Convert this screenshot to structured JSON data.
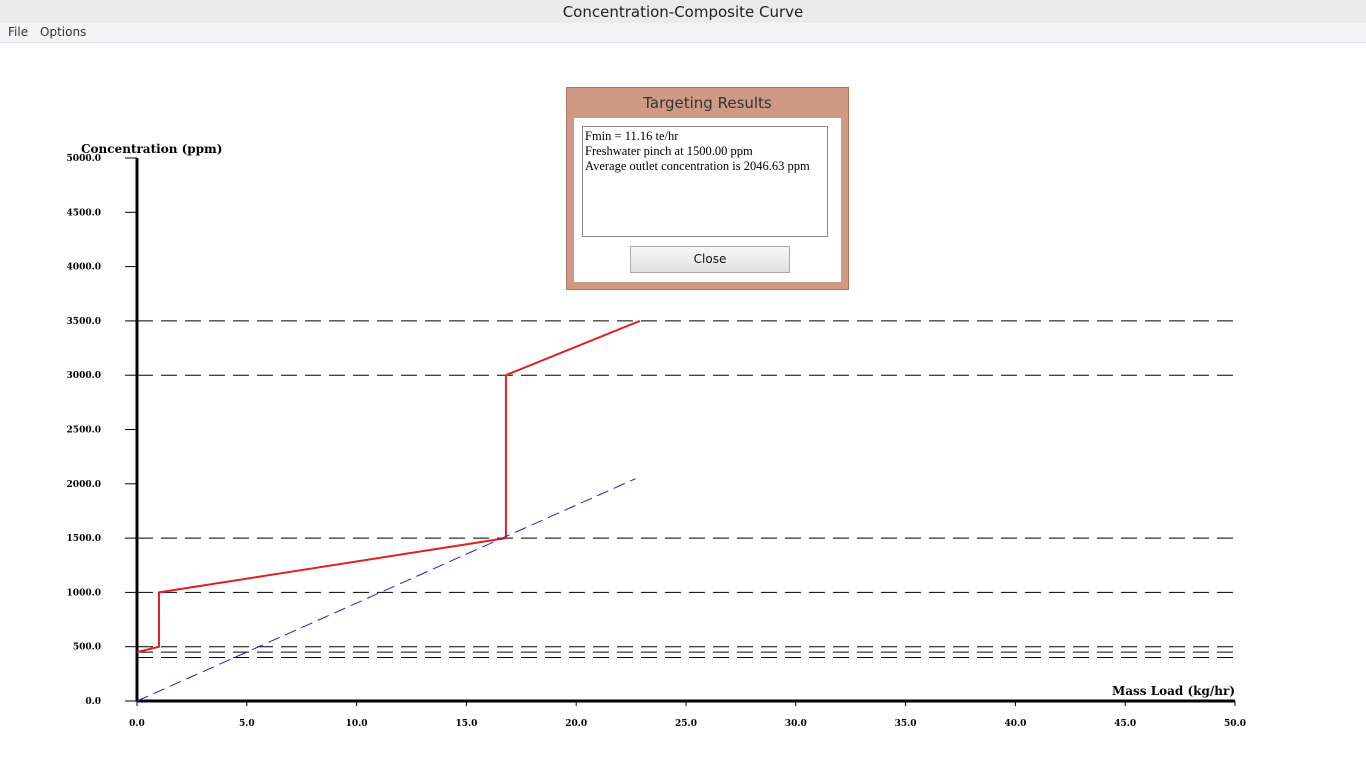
{
  "window": {
    "title": "Concentration-Composite Curve"
  },
  "menu": {
    "items": [
      "File",
      "Options"
    ]
  },
  "dialog": {
    "title": "Targeting Results",
    "lines": [
      "Fmin = 11.16 te/hr",
      "Freshwater pinch at 1500.00 ppm",
      "Average outlet concentration is 2046.63 ppm"
    ],
    "close_label": "Close"
  },
  "chart_data": {
    "type": "line",
    "xlabel": "Mass Load (kg/hr)",
    "ylabel": "Concentration (ppm)",
    "xlim": [
      0,
      50
    ],
    "ylim": [
      0,
      5000
    ],
    "xticks": [
      "0.0",
      "5.0",
      "10.0",
      "15.0",
      "20.0",
      "25.0",
      "30.0",
      "35.0",
      "40.0",
      "45.0",
      "50.0"
    ],
    "yticks": [
      "0.0",
      "500.0",
      "1000.0",
      "1500.0",
      "2000.0",
      "2500.0",
      "3000.0",
      "3500.0",
      "4000.0",
      "4500.0",
      "5000.0"
    ],
    "concentration_levels": [
      400,
      450,
      500,
      1000,
      1500,
      3000,
      3500
    ],
    "series": [
      {
        "color": "#e02020",
        "style": "solid",
        "x": [
          0,
          1.0,
          1.0,
          16.8,
          16.8,
          22.9
        ],
        "y": [
          450,
          500,
          1000,
          1500,
          3000,
          3500
        ]
      },
      {
        "color": "#2020c0",
        "style": "dashed",
        "x": [
          0,
          22.7
        ],
        "y": [
          0,
          2046.63
        ]
      }
    ]
  }
}
